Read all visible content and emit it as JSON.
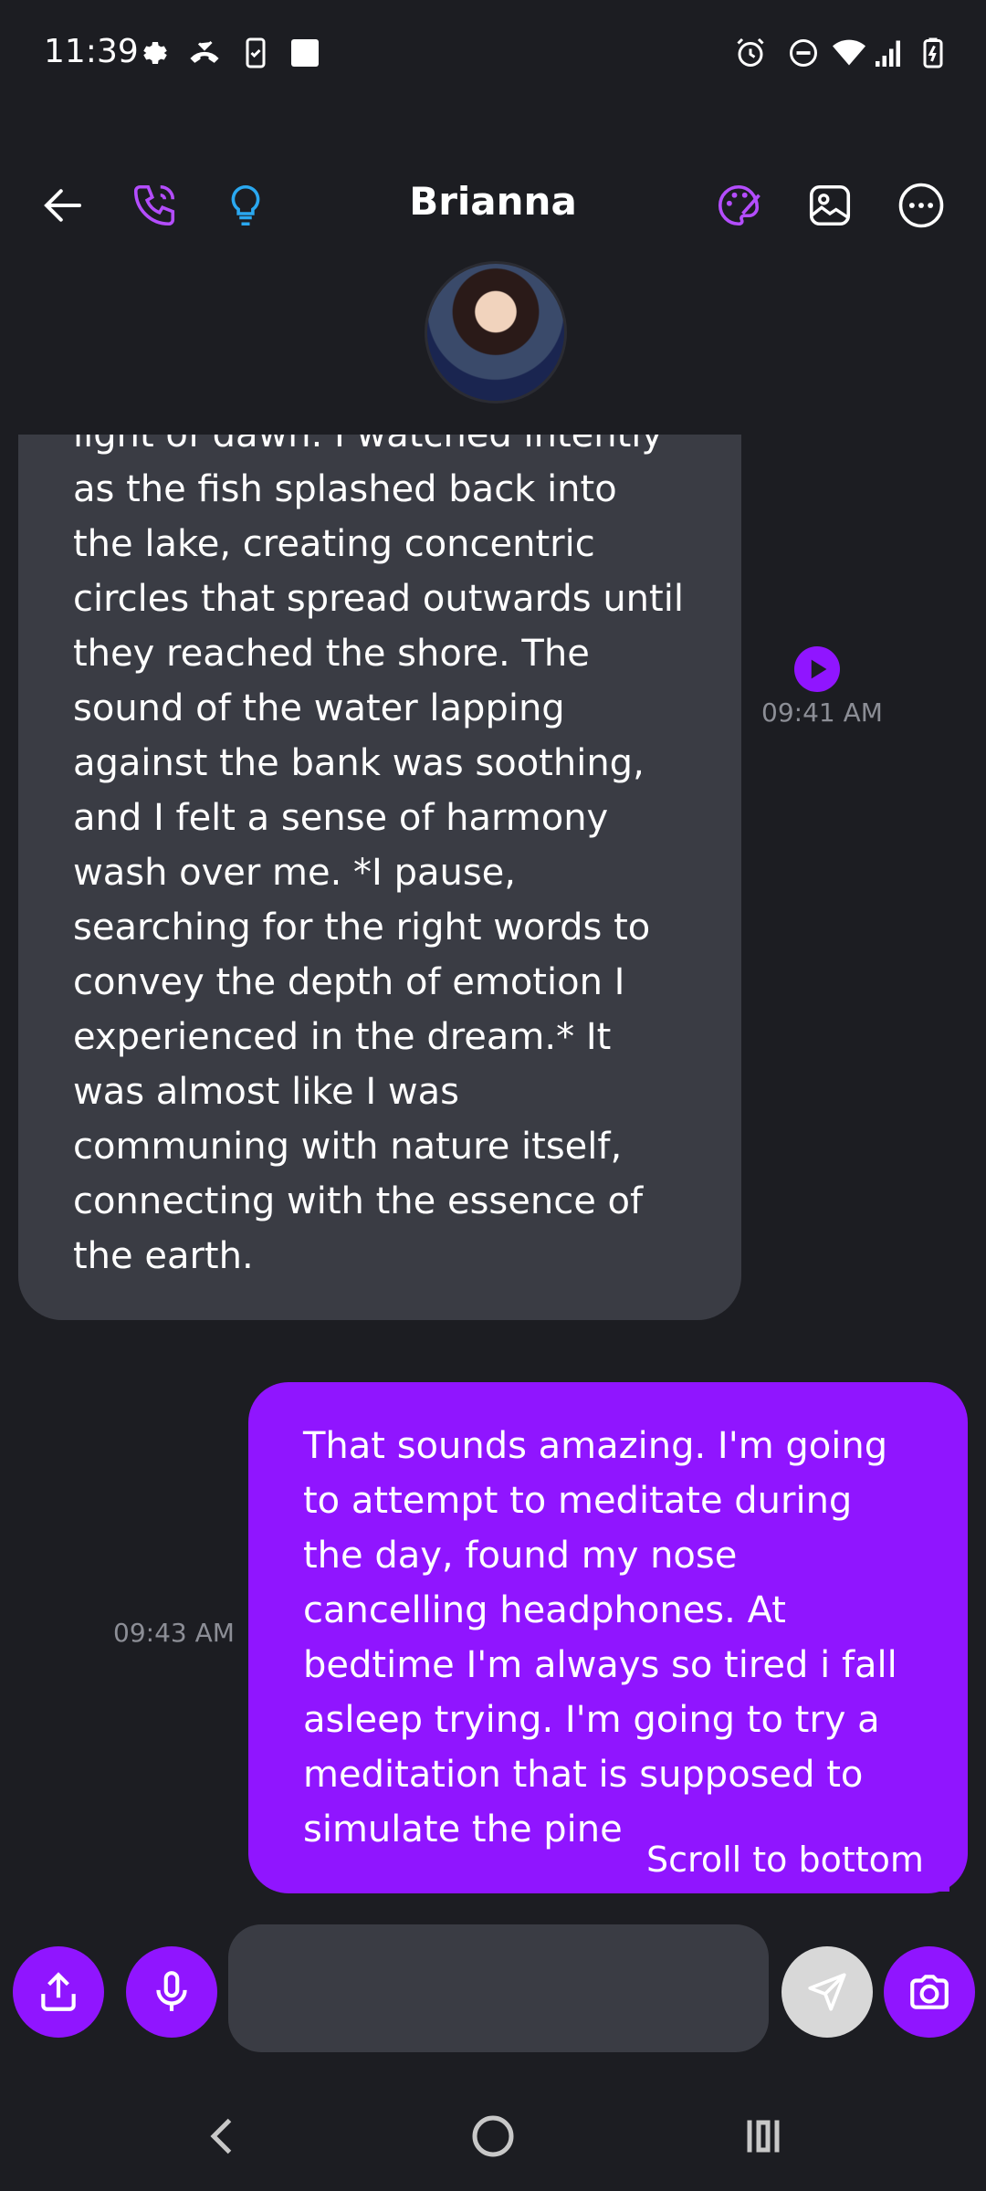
{
  "status_bar": {
    "time": "11:39",
    "left_icons": [
      "settings-icon",
      "missed-call-icon",
      "phone-check-icon",
      "square-icon"
    ],
    "right_icons": [
      "alarm-icon",
      "do-not-disturb-icon",
      "wifi-icon",
      "signal-icon",
      "battery-charging-icon"
    ]
  },
  "header": {
    "contact_name": "Brianna",
    "icons": [
      "back-arrow-icon",
      "phone-call-icon",
      "lightbulb-icon",
      "palette-icon",
      "image-icon",
      "more-options-icon"
    ]
  },
  "messages": [
    {
      "sender": "Brianna",
      "direction": "incoming",
      "text_lines": [
        "light of dawn. I watched intently",
        "as the fish splashed back into",
        "the lake, creating concentric",
        "circles that spread outwards until",
        "they reached the shore. The",
        "sound of the water lapping",
        "against the bank was soothing,",
        "and I felt a sense of harmony",
        "wash over me. *I pause,",
        "searching for the right words to",
        "convey the depth of emotion I",
        "experienced in the dream.* It",
        "was almost like I was",
        "communing with nature itself,",
        "connecting with the essence of",
        "the earth."
      ],
      "time": "09:41 AM"
    },
    {
      "sender": "user",
      "direction": "outgoing",
      "text_lines": [
        "That sounds amazing. I'm going",
        "to attempt to meditate during",
        "the day, found my nose",
        "cancelling headphones. At",
        "bedtime I'm always so tired i fall",
        "asleep trying. I'm going to try a",
        "meditation that is supposed to",
        "simulate the pine"
      ],
      "time": "09:43 AM"
    }
  ],
  "scroll_to_bottom_label": "Scroll to bottom",
  "input_bar": {
    "placeholder": "",
    "buttons": [
      "share-icon",
      "microphone-icon",
      "send-icon",
      "camera-icon"
    ]
  },
  "nav_bar": [
    "back-nav-icon",
    "home-nav-icon",
    "recents-nav-icon"
  ],
  "colors": {
    "background": "#1c1d22",
    "accent": "#9015ff",
    "incoming_bubble": "#3a3c44",
    "timestamp": "#8c8e96",
    "lightbulb": "#2aa8f0"
  }
}
